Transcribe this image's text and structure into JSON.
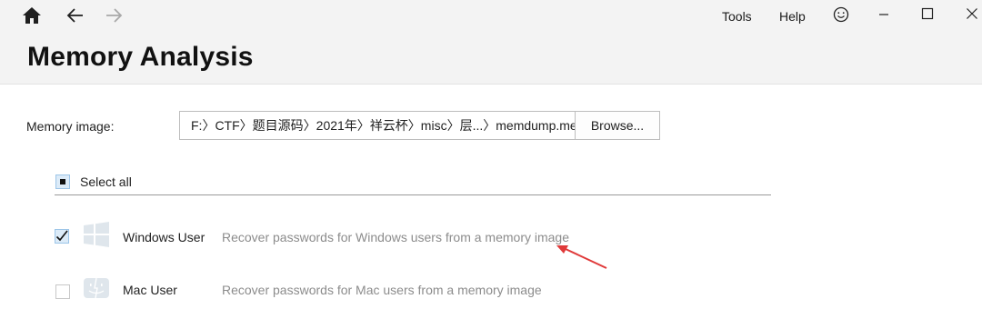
{
  "toolbar": {
    "home_icon": "home-icon",
    "back_icon": "arrow-left-icon",
    "forward_icon": "arrow-right-icon",
    "menu": {
      "tools": "Tools",
      "help": "Help"
    },
    "feedback_icon": "smiley-icon",
    "window_controls": [
      "minimize-icon",
      "maximize-icon",
      "close-icon"
    ]
  },
  "page": {
    "title": "Memory Analysis"
  },
  "memory_image": {
    "label": "Memory image:",
    "path": "F:〉CTF〉题目源码〉2021年〉祥云杯〉misc〉层...〉memdump.me...",
    "browse_label": "Browse..."
  },
  "select_all": {
    "label": "Select all",
    "state": "partial"
  },
  "items": [
    {
      "name": "Windows User",
      "description": "Recover passwords for Windows users from a memory image",
      "checked": true,
      "icon": "windows-logo-icon"
    },
    {
      "name": "Mac User",
      "description": "Recover passwords for Mac users from a memory image",
      "checked": false,
      "icon": "mac-finder-icon"
    }
  ],
  "colors": {
    "header_bg": "#f3f3f3",
    "annotation_arrow": "#e03a3a",
    "checkbox_accent": "#dcebf8"
  }
}
